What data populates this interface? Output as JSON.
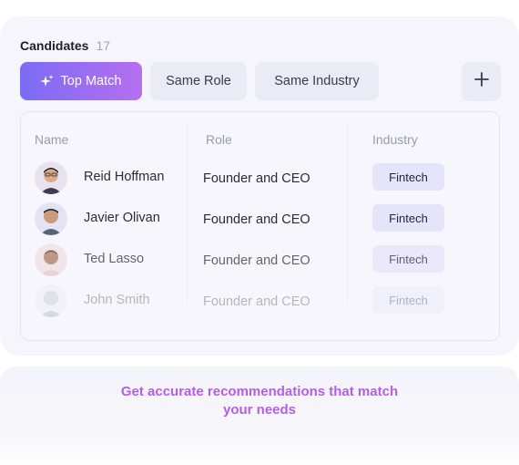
{
  "header": {
    "title": "Candidates",
    "count": "17"
  },
  "tabs": [
    {
      "label": "Top Match",
      "icon": "sparkle-icon",
      "active": true
    },
    {
      "label": "Same Role"
    },
    {
      "label": "Same Industry"
    }
  ],
  "add_button": {
    "icon": "plus-icon"
  },
  "table": {
    "columns": [
      "Name",
      "Role",
      "Industry"
    ],
    "rows": [
      {
        "name": "Reid Hoffman",
        "role": "Founder and CEO",
        "industry": "Fintech"
      },
      {
        "name": "Javier Olivan",
        "role": "Founder and CEO",
        "industry": "Fintech"
      },
      {
        "name": "Ted Lasso",
        "role": "Founder and CEO",
        "industry": "Fintech"
      },
      {
        "name": "John Smith",
        "role": "Founder and CEO",
        "industry": "Fintech"
      }
    ]
  },
  "footer": {
    "message_line1": "Get accurate recommendations that match",
    "message_line2": "your needs"
  },
  "colors": {
    "accent_start": "#7b6cf4",
    "accent_end": "#b56ff0",
    "footer_text": "#b65de8"
  }
}
